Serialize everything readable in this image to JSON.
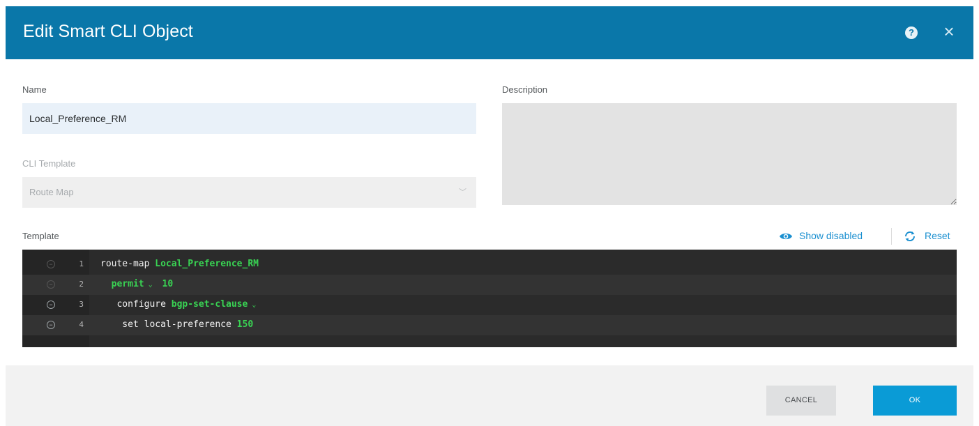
{
  "dialog": {
    "title": "Edit Smart CLI Object",
    "help_icon": "question-circle-icon",
    "close_icon": "close-icon"
  },
  "form": {
    "name_label": "Name",
    "name_value": "Local_Preference_RM",
    "cli_template_label": "CLI Template",
    "cli_template_value": "Route Map",
    "description_label": "Description",
    "description_value": "",
    "template_label": "Template"
  },
  "template_actions": {
    "show_disabled_label": "Show disabled",
    "reset_label": "Reset"
  },
  "code_lines": [
    {
      "n": "1",
      "parts": [
        {
          "t": "route-map ",
          "c": "kw"
        },
        {
          "t": "Local_Preference_RM",
          "c": "g"
        }
      ]
    },
    {
      "n": "2",
      "parts": [
        {
          "t": "  ",
          "c": "kw"
        },
        {
          "t": "permit",
          "c": "g"
        },
        {
          "t": " ⌄ ",
          "c": "caret"
        },
        {
          "t": " 10",
          "c": "g"
        }
      ]
    },
    {
      "n": "3",
      "parts": [
        {
          "t": "   configure ",
          "c": "kw"
        },
        {
          "t": "bgp-set-clause",
          "c": "g"
        },
        {
          "t": " ⌄",
          "c": "caret"
        }
      ]
    },
    {
      "n": "4",
      "parts": [
        {
          "t": "    set local-preference ",
          "c": "kw"
        },
        {
          "t": "150",
          "c": "g"
        }
      ]
    }
  ],
  "footer": {
    "cancel_label": "CANCEL",
    "ok_label": "OK"
  },
  "colors": {
    "header": "#0a77a9",
    "accent": "#0a9bd6",
    "code_bg": "#2b2b2b",
    "code_green": "#39d353"
  }
}
